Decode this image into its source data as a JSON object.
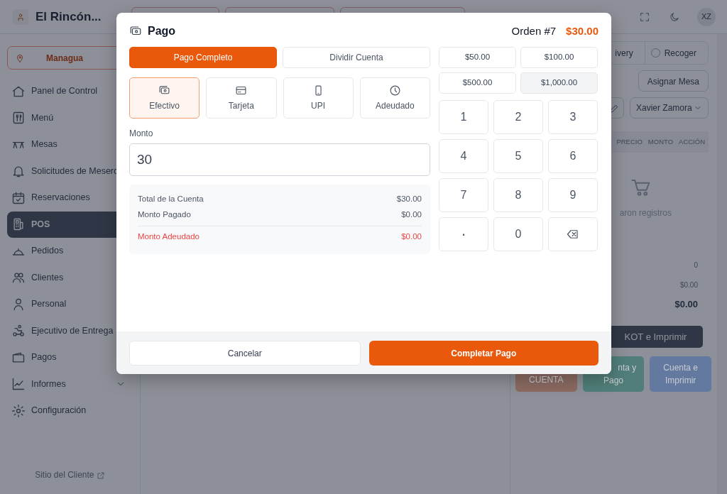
{
  "header": {
    "brand": "El Rincón...",
    "user_initials": "XZ"
  },
  "sidebar": {
    "location": "Managua",
    "items": [
      {
        "label": "Panel de Control",
        "selected": false,
        "kind": "link"
      },
      {
        "label": "Menú",
        "selected": false,
        "kind": "link"
      },
      {
        "label": "Mesas",
        "selected": false,
        "kind": "link"
      },
      {
        "label": "Solicitudes de Meserc",
        "selected": false,
        "kind": "link"
      },
      {
        "label": "Reservaciones",
        "selected": false,
        "kind": "link"
      },
      {
        "label": "POS",
        "selected": true,
        "kind": "link"
      },
      {
        "label": "Pedidos",
        "selected": false,
        "kind": "link"
      },
      {
        "label": "Clientes",
        "selected": false,
        "kind": "link"
      },
      {
        "label": "Personal",
        "selected": false,
        "kind": "link"
      },
      {
        "label": "Ejecutivo de Entrega",
        "selected": false,
        "kind": "link"
      },
      {
        "label": "Pagos",
        "selected": false,
        "kind": "link"
      },
      {
        "label": "Informes",
        "selected": false,
        "kind": "group"
      },
      {
        "label": "Configuración",
        "selected": false,
        "kind": "link"
      }
    ],
    "footer_link": "Sitio del Cliente"
  },
  "order_panel": {
    "order_types": [
      {
        "label": "ivery",
        "kind": "button",
        "selected": false
      },
      {
        "label": "Recoger",
        "kind": "radio",
        "selected": false
      }
    ],
    "assign_table": "Asignar Mesa",
    "waiter": "Xavier Zamora",
    "columns": [
      "PRECIO",
      "MONTO",
      "ACCIÓN"
    ],
    "empty_text": "aron registros",
    "summary": [
      {
        "value": "0",
        "kind": "normal"
      },
      {
        "value": "$0.00",
        "kind": "normal"
      },
      {
        "value": "$0.00",
        "kind": "total"
      }
    ],
    "kot_button": "KOT e Imprimir",
    "actions": [
      {
        "lines": [
          "CUENTA"
        ],
        "color": "#8b6b62"
      },
      {
        "lines": [
          "nta y",
          "Pago"
        ],
        "color": "#517e79"
      },
      {
        "lines": [
          "Cuenta e",
          "Imprimir"
        ],
        "color": "#6379a0"
      }
    ]
  },
  "payment_modal": {
    "title": "Pago",
    "order": "Orden #7",
    "total": "$30.00",
    "modes": [
      {
        "label": "Pago Completo",
        "selected": true
      },
      {
        "label": "Dividir Cuenta",
        "selected": false
      }
    ],
    "methods": [
      {
        "label": "Efectivo",
        "selected": true
      },
      {
        "label": "Tarjeta",
        "selected": false
      },
      {
        "label": "UPI",
        "selected": false
      },
      {
        "label": "Adeudado",
        "selected": false
      }
    ],
    "amount": {
      "label": "Monto",
      "value": "30"
    },
    "summary": [
      {
        "label": "Total de la Cuenta",
        "value": "$30.00",
        "kind": "normal"
      },
      {
        "label": "Monto Pagado",
        "value": "$0.00",
        "kind": "normal"
      },
      {
        "label": "Monto Adeudado",
        "value": "$0.00",
        "kind": "due"
      }
    ],
    "quick_amounts": [
      {
        "label": "$50.00",
        "selected": false
      },
      {
        "label": "$100.00",
        "selected": false
      },
      {
        "label": "$500.00",
        "selected": false
      },
      {
        "label": "$1,000.00",
        "selected": true
      }
    ],
    "keys": [
      {
        "kind": "digit",
        "label": "1"
      },
      {
        "kind": "digit",
        "label": "2"
      },
      {
        "kind": "digit",
        "label": "3"
      },
      {
        "kind": "digit",
        "label": "4"
      },
      {
        "kind": "digit",
        "label": "5"
      },
      {
        "kind": "digit",
        "label": "6"
      },
      {
        "kind": "digit",
        "label": "7"
      },
      {
        "kind": "digit",
        "label": "8"
      },
      {
        "kind": "digit",
        "label": "9"
      },
      {
        "kind": "decimal",
        "label": "."
      },
      {
        "kind": "digit",
        "label": "0"
      },
      {
        "kind": "backspace"
      }
    ],
    "cancel": "Cancelar",
    "confirm": "Completar Pago"
  }
}
